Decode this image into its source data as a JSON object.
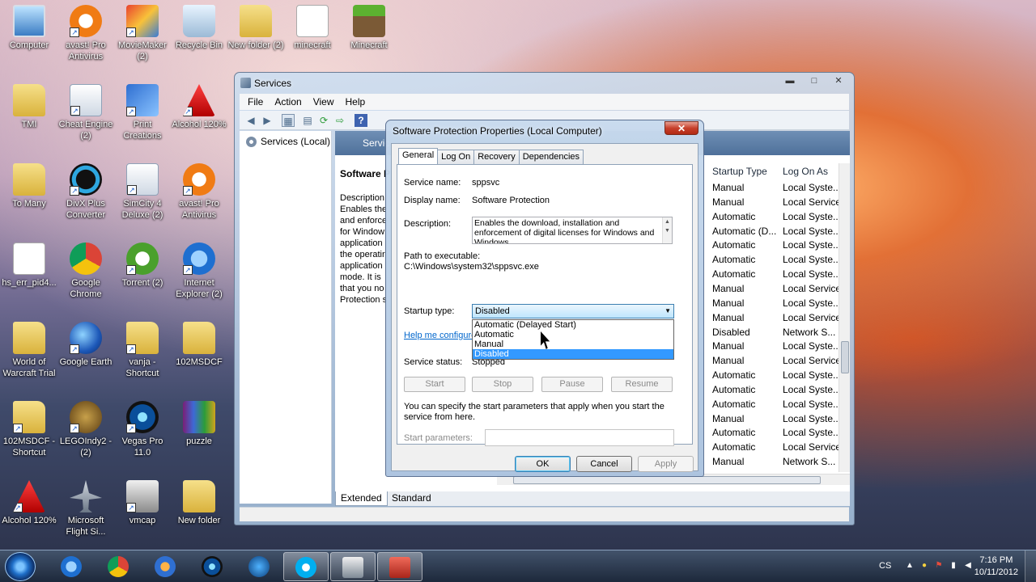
{
  "desktop": {
    "icons": [
      {
        "label": "Computer",
        "icon": "computer-icon"
      },
      {
        "label": "avast! Pro Antivirus",
        "icon": "avast-icon"
      },
      {
        "label": "MovieMaker (2)",
        "icon": "moviemaker-icon"
      },
      {
        "label": "Recycle Bin",
        "icon": "recycle-bin-icon"
      },
      {
        "label": "New folder (2)",
        "icon": "folder-icon"
      },
      {
        "label": "minecraft",
        "icon": "java-file-icon"
      },
      {
        "label": "Minecraft",
        "icon": "minecraft-icon"
      },
      {
        "label": "TMI",
        "icon": "folder-icon"
      },
      {
        "label": "Cheat Engine (2)",
        "icon": "cheat-engine-icon"
      },
      {
        "label": "Print Creations",
        "icon": "print-creations-icon"
      },
      {
        "label": "Alcohol 120%",
        "icon": "alcohol-icon"
      },
      {
        "label": "To Many",
        "icon": "folder-icon"
      },
      {
        "label": "DivX Plus Converter",
        "icon": "divx-icon"
      },
      {
        "label": "SimCity 4 Deluxe (2)",
        "icon": "simcity-icon"
      },
      {
        "label": "avast! Pro Antivirus",
        "icon": "avast-icon"
      },
      {
        "label": "hs_err_pid4...",
        "icon": "text-file-icon"
      },
      {
        "label": "Google Chrome",
        "icon": "chrome-icon"
      },
      {
        "label": "Torrent (2)",
        "icon": "utorrent-icon"
      },
      {
        "label": "Internet Explorer (2)",
        "icon": "ie-icon"
      },
      {
        "label": "World of Warcraft Trial",
        "icon": "folder-icon"
      },
      {
        "label": "Google Earth",
        "icon": "google-earth-icon"
      },
      {
        "label": "vanja - Shortcut",
        "icon": "folder-icon"
      },
      {
        "label": "102MSDCF",
        "icon": "folder-icon"
      },
      {
        "label": "102MSDCF - Shortcut",
        "icon": "folder-icon"
      },
      {
        "label": "LEGOIndy2 - (2)",
        "icon": "lego-icon"
      },
      {
        "label": "Vegas Pro 11.0",
        "icon": "vegas-icon"
      },
      {
        "label": "puzzle",
        "icon": "winrar-icon"
      },
      {
        "label": "Alcohol 120%",
        "icon": "alcohol-icon"
      },
      {
        "label": "Microsoft Flight Si...",
        "icon": "flight-sim-icon"
      },
      {
        "label": "vmcap",
        "icon": "vmcap-icon"
      },
      {
        "label": "New folder",
        "icon": "folder-icon"
      }
    ]
  },
  "services": {
    "title": "Services",
    "caption": {
      "min": "▬",
      "max": "□",
      "close": "✕"
    },
    "menu": [
      "File",
      "Action",
      "View",
      "Help"
    ],
    "tree_root": "Services (Local)",
    "header": "Servic",
    "desc_title": "Software P",
    "desc_lines": [
      "Description",
      "Enables the",
      "and enforce",
      "for Window",
      "application",
      "the operatir",
      "application",
      "mode. It is",
      "that you no",
      "Protection s"
    ],
    "columns": {
      "startup": "Startup Type",
      "logon": "Log On As"
    },
    "rows": [
      {
        "startup": "Manual",
        "logon": "Local Syste..."
      },
      {
        "startup": "Manual",
        "logon": "Local Service"
      },
      {
        "startup": "Automatic",
        "logon": "Local Syste..."
      },
      {
        "startup": "Automatic (D...",
        "logon": "Local Syste..."
      },
      {
        "startup": "Automatic",
        "logon": "Local Syste..."
      },
      {
        "startup": "Automatic",
        "logon": "Local Syste..."
      },
      {
        "startup": "Automatic",
        "logon": "Local Syste..."
      },
      {
        "startup": "Manual",
        "logon": "Local Service"
      },
      {
        "startup": "Manual",
        "logon": "Local Syste..."
      },
      {
        "startup": "Manual",
        "logon": "Local Service"
      },
      {
        "startup": "Disabled",
        "logon": "Network S..."
      },
      {
        "startup": "Manual",
        "logon": "Local Syste..."
      },
      {
        "startup": "Manual",
        "logon": "Local Service"
      },
      {
        "startup": "Automatic",
        "logon": "Local Syste..."
      },
      {
        "startup": "Automatic",
        "logon": "Local Syste..."
      },
      {
        "startup": "Automatic",
        "logon": "Local Syste..."
      },
      {
        "startup": "Manual",
        "logon": "Local Syste..."
      },
      {
        "startup": "Automatic",
        "logon": "Local Syste..."
      },
      {
        "startup": "Automatic",
        "logon": "Local Service"
      },
      {
        "startup": "Manual",
        "logon": "Network S..."
      }
    ],
    "view_tabs": [
      "Extended",
      "Standard"
    ]
  },
  "dialog": {
    "title": "Software Protection Properties (Local Computer)",
    "close": "✕",
    "tabs": [
      "General",
      "Log On",
      "Recovery",
      "Dependencies"
    ],
    "service_name_label": "Service name:",
    "service_name": "sppsvc",
    "display_name_label": "Display name:",
    "display_name": "Software Protection",
    "description_label": "Description:",
    "description": "Enables the download, installation and enforcement of digital licenses for Windows and Windows",
    "path_label": "Path to executable:",
    "path": "C:\\Windows\\system32\\sppsvc.exe",
    "startup_label": "Startup type:",
    "startup_value": "Disabled",
    "startup_options": [
      "Automatic (Delayed Start)",
      "Automatic",
      "Manual",
      "Disabled"
    ],
    "startup_selected_index": 3,
    "help_link": "Help me configure",
    "status_label": "Service status:",
    "status_value": "Stopped",
    "buttons": {
      "start": "Start",
      "stop": "Stop",
      "pause": "Pause",
      "resume": "Resume"
    },
    "hint": "You can specify the start parameters that apply when you start the service from here.",
    "params_label": "Start parameters:",
    "params_value": "",
    "ok": "OK",
    "cancel": "Cancel",
    "apply": "Apply"
  },
  "taskbar": {
    "apps": [
      "internet-explorer-icon",
      "chrome-icon",
      "windows-media-icon",
      "vegas-icon",
      "bs-player-icon",
      "skype-icon",
      "folder-window-icon",
      "services-toolbox-icon"
    ],
    "active_index": 7,
    "language": "CS",
    "time": "7:16 PM",
    "date": "10/11/2012"
  }
}
